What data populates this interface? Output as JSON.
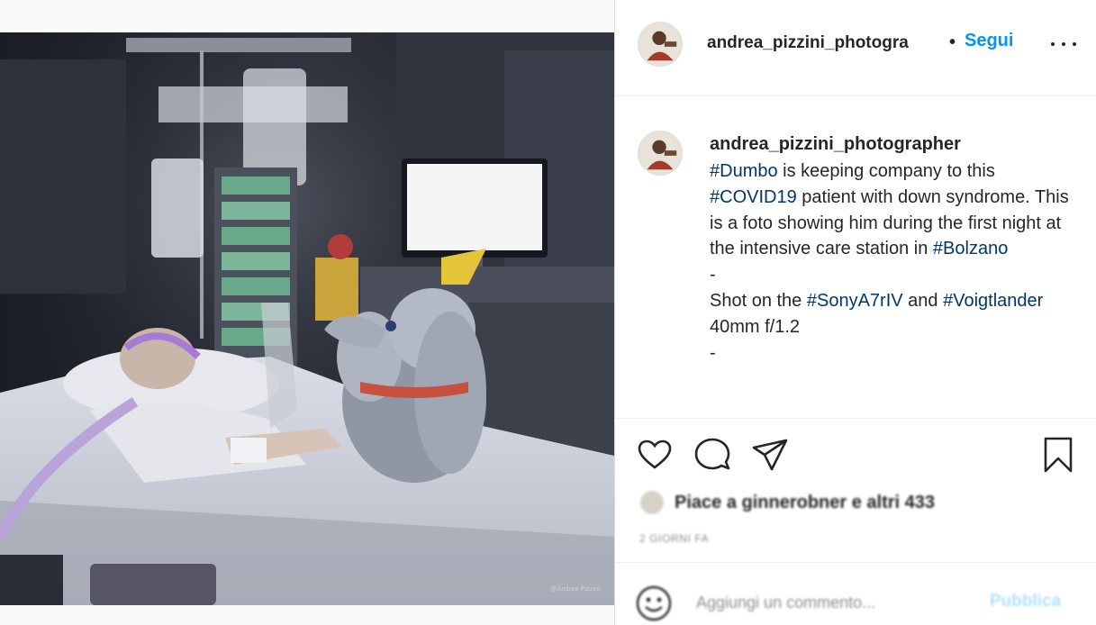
{
  "photo": {
    "credit": "@Andrea Pizzini"
  },
  "header": {
    "username": "andrea_pizzini_photogra",
    "separator": "•",
    "follow_label": "Segui",
    "more_icon": "more-horizontal-icon"
  },
  "caption": {
    "username": "andrea_pizzini_photographer",
    "segments": [
      {
        "text": "#Dumbo",
        "tag": true
      },
      {
        "text": " is keeping company to this ",
        "tag": false
      },
      {
        "text": "#COVID19",
        "tag": true
      },
      {
        "text": " patient with down syndrome. This is a foto showing him during the first night at the intensive care station in ",
        "tag": false
      },
      {
        "text": "#Bolzano",
        "tag": true
      },
      {
        "text": "\n-\nShot on the ",
        "tag": false
      },
      {
        "text": "#SonyA7rIV",
        "tag": true
      },
      {
        "text": " and ",
        "tag": false
      },
      {
        "text": "#Voigtlander",
        "tag": true
      },
      {
        "text": " 40mm f/1.2\n-",
        "tag": false
      }
    ]
  },
  "actions": {
    "icons": [
      "heart-icon",
      "comment-icon",
      "share-icon",
      "bookmark-icon"
    ],
    "likes_text": "Piace a ginnerobner e altri 433",
    "timestamp": "2 GIORNI FA"
  },
  "comment": {
    "placeholder": "Aggiungi un commento...",
    "publish_label": "Pubblica",
    "emoji_icon": "emoji-icon"
  },
  "colors": {
    "accent": "#0095f6",
    "hashtag": "#00376b",
    "publish_disabled": "#b2dffc",
    "muted": "#8e8e8e"
  }
}
